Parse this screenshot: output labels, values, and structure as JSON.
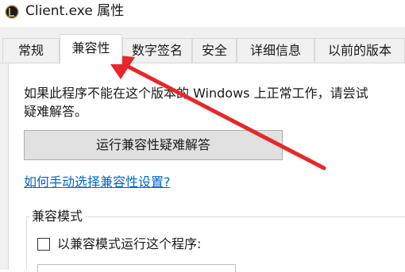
{
  "window": {
    "title": "Client.exe 属性",
    "icon": "league-client-icon"
  },
  "tabs": [
    {
      "label": "常规",
      "active": false
    },
    {
      "label": "兼容性",
      "active": true
    },
    {
      "label": "数字签名",
      "active": false
    },
    {
      "label": "安全",
      "active": false
    },
    {
      "label": "详细信息",
      "active": false
    },
    {
      "label": "以前的版本",
      "active": false
    }
  ],
  "compat": {
    "description_line1": "如果此程序不能在这个版本的 Windows 上正常工作，请尝试",
    "description_line2": "疑难解答。",
    "troubleshoot_button": "运行兼容性疑难解答",
    "manual_link": "如何手动选择兼容性设置?",
    "mode_group_label": "兼容模式",
    "mode_checkbox_label": "以兼容模式运行这个程序:",
    "mode_checked": false
  },
  "annotation": {
    "color": "#e8272b",
    "icon": "red-arrow-annotation",
    "points_to": "兼容性"
  }
}
